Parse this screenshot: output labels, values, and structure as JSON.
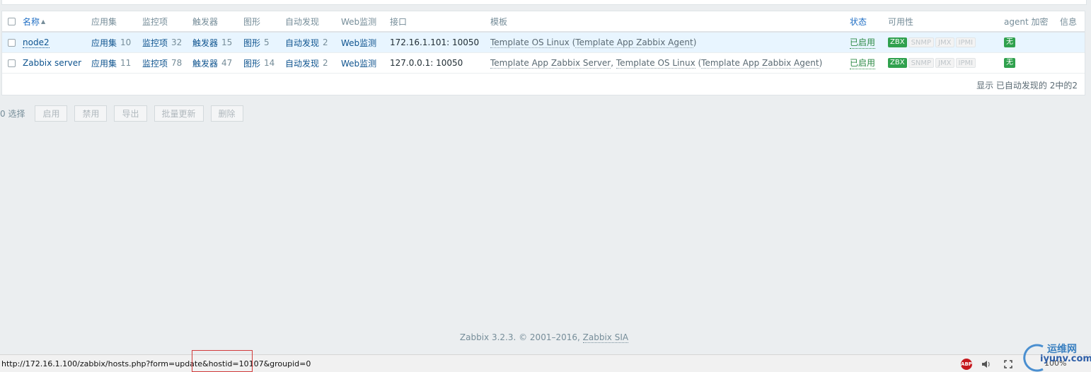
{
  "table": {
    "headers": {
      "name": "名称",
      "sort_arrow": "▲",
      "applications": "应用集",
      "items": "监控项",
      "triggers": "触发器",
      "graphs": "图形",
      "discovery": "自动发现",
      "web": "Web监测",
      "interface": "接口",
      "templates": "模板",
      "status": "状态",
      "availability": "可用性",
      "agent_encryption": "agent 加密",
      "info": "信息"
    },
    "rows": [
      {
        "name": "node2",
        "applications_label": "应用集",
        "applications_count": "10",
        "items_label": "监控项",
        "items_count": "32",
        "triggers_label": "触发器",
        "triggers_count": "15",
        "graphs_label": "图形",
        "graphs_count": "5",
        "discovery_label": "自动发现",
        "discovery_count": "2",
        "web_label": "Web监测",
        "interface": "172.16.1.101: 10050",
        "tpl1": "Template OS Linux",
        "tpl_open": " (",
        "tpl_paren": "Template App Zabbix Agent",
        "tpl_close": ")",
        "status": "已启用",
        "avail": [
          "ZBX",
          "SNMP",
          "JMX",
          "IPMI"
        ],
        "encryption": "无"
      },
      {
        "name": "Zabbix server",
        "applications_label": "应用集",
        "applications_count": "11",
        "items_label": "监控项",
        "items_count": "78",
        "triggers_label": "触发器",
        "triggers_count": "47",
        "graphs_label": "图形",
        "graphs_count": "14",
        "discovery_label": "自动发现",
        "discovery_count": "2",
        "web_label": "Web监测",
        "interface": "127.0.0.1: 10050",
        "tpl1": "Template App Zabbix Server",
        "tpl_sep": ", ",
        "tpl2": "Template OS Linux",
        "tpl_open": " (",
        "tpl_paren": "Template App Zabbix Agent",
        "tpl_close": ")",
        "status": "已启用",
        "avail": [
          "ZBX",
          "SNMP",
          "JMX",
          "IPMI"
        ],
        "encryption": "无"
      }
    ],
    "footer": "显示 已自动发现的 2中的2"
  },
  "actions": {
    "selected": "0 选择",
    "enable": "启用",
    "disable": "禁用",
    "export": "导出",
    "mass_update": "批量更新",
    "delete": "删除"
  },
  "footer": {
    "copyright": "Zabbix 3.2.3. © 2001–2016,",
    "company": "Zabbix SIA"
  },
  "statusbar": {
    "url": "http://172.16.1.100/zabbix/hosts.php?form=update&hostid=10107&groupid=0",
    "abp": "ABP",
    "zoom": "100%"
  },
  "watermark": {
    "cn": "运维网",
    "en": "iyunv.com"
  },
  "colors": {
    "link": "#0f548f",
    "enabled_green": "#2c8a45",
    "zbx_badge": "#30a14e",
    "highlight_box": "#d23b3b"
  }
}
